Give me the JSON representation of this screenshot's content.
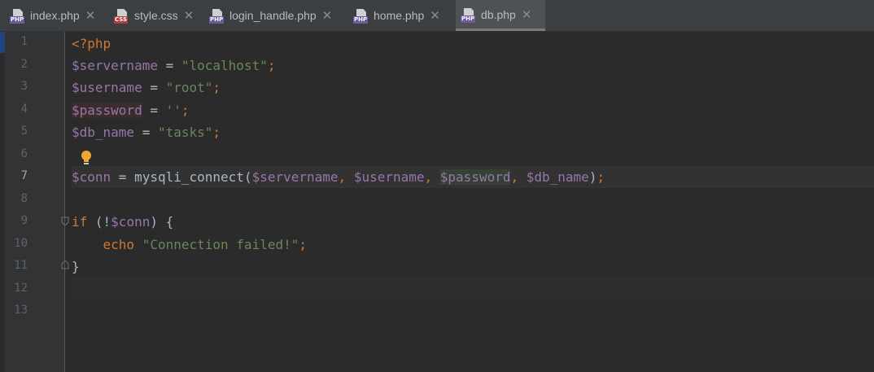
{
  "tabs": [
    {
      "name": "index.php",
      "icon": "php-file-icon",
      "badge": "PHP",
      "badge_color": "#6e5aa0"
    },
    {
      "name": "style.css",
      "icon": "css-file-icon",
      "badge": "CSS",
      "badge_color": "#b23b3b"
    },
    {
      "name": "login_handle.php",
      "icon": "php-file-icon",
      "badge": "PHP",
      "badge_color": "#6e5aa0"
    },
    {
      "name": "home.php",
      "icon": "php-file-icon",
      "badge": "PHP",
      "badge_color": "#6e5aa0"
    },
    {
      "name": "db.php",
      "icon": "php-file-icon",
      "badge": "PHP",
      "badge_color": "#6e5aa0",
      "active": true
    }
  ],
  "close_glyph": "✕",
  "line_numbers": [
    "1",
    "2",
    "3",
    "4",
    "5",
    "6",
    "7",
    "8",
    "9",
    "10",
    "11",
    "12",
    "13"
  ],
  "current_line": "7",
  "code": {
    "l1": {
      "open_tag": "<?php"
    },
    "l2": {
      "var": "$servername",
      "op": " = ",
      "val": "\"localhost\"",
      "end": ";"
    },
    "l3": {
      "var": "$username",
      "op": " = ",
      "val": "\"root\"",
      "end": ";"
    },
    "l4": {
      "var": "$password",
      "op": " = ",
      "val": "''",
      "end": ";"
    },
    "l5": {
      "var": "$db_name",
      "op": " = ",
      "val": "\"tasks\"",
      "end": ";"
    },
    "l7": {
      "var": "$conn",
      "op": " = ",
      "func": "mysqli_connect(",
      "a1": "$servername",
      "c1": ", ",
      "a2": "$username",
      "c2": ", ",
      "a3": "$password",
      "c3": ", ",
      "a4": "$db_name",
      "close": ")",
      "end": ";"
    },
    "l9": {
      "kw": "if",
      "pre": " (!",
      "var": "$conn",
      "post": ") {"
    },
    "l10": {
      "indent": "    ",
      "kw": "echo",
      "sp": " ",
      "str": "\"Connection failed!\"",
      "end": ";"
    },
    "l11": {
      "brace": "}"
    }
  },
  "colors": {
    "keyword": "#cc7832",
    "variable": "#9876aa",
    "string": "#6a8759",
    "plain": "#a9b7c6",
    "background": "#2b2b2b",
    "gutter": "#313335",
    "bulb": "#f0a732"
  }
}
